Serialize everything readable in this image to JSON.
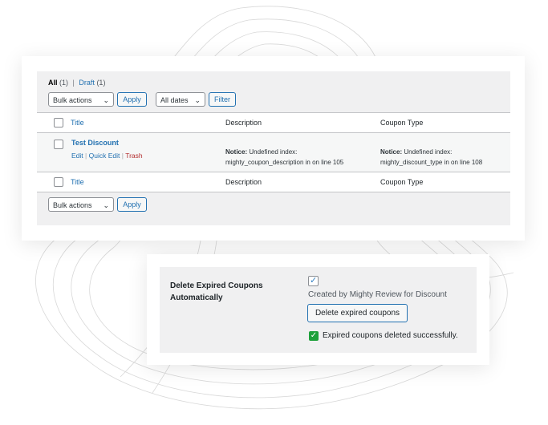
{
  "list_screen": {
    "filters": {
      "all_label": "All",
      "all_count": "(1)",
      "separator": "|",
      "draft_label": "Draft",
      "draft_count": "(1)"
    },
    "bulk_actions_top": "Bulk actions",
    "apply_top": "Apply",
    "dates_select": "All dates",
    "filter_button": "Filter",
    "columns": {
      "title": "Title",
      "description": "Description",
      "coupon_type": "Coupon Type"
    },
    "row": {
      "title": "Test Discount",
      "edit": "Edit",
      "quick_edit": "Quick Edit",
      "trash": "Trash",
      "action_sep": "|",
      "description_notice_label": "Notice:",
      "description_notice_line1": "Undefined index:",
      "description_notice_line2": "mighty_coupon_description in on line 105",
      "type_notice_label": "Notice:",
      "type_notice_line1": "Undefined index:",
      "type_notice_line2": "mighty_discount_type in on line 108"
    },
    "bulk_actions_bottom": "Bulk actions",
    "apply_bottom": "Apply"
  },
  "settings": {
    "field_label": "Delete Expired Coupons Automatically",
    "checked": true,
    "description": "Created by Mighty Review for Discount",
    "button_label": "Delete expired coupons",
    "success_message": "Expired coupons deleted successfully."
  },
  "icons": {
    "chevron": "chevron-down-icon",
    "check": "checkmark-icon",
    "success": "success-check-icon"
  },
  "colors": {
    "link": "#2271b1",
    "trash": "#b32d2e",
    "success": "#1ea03b",
    "panel_bg": "#f0f0f1"
  }
}
